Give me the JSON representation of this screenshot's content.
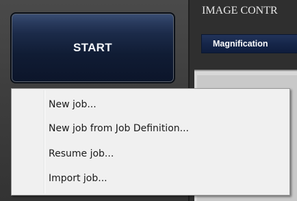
{
  "start_button": {
    "label": "START"
  },
  "image_control": {
    "title": "IMAGE CONTR",
    "tab_label": "Magnification"
  },
  "context_menu": {
    "items": [
      {
        "label": "New job..."
      },
      {
        "label": "New job from Job Definition..."
      },
      {
        "label": "Resume job..."
      },
      {
        "label": "Import job..."
      }
    ]
  },
  "colors": {
    "start_button_top": "#3b4f74",
    "start_button_bottom": "#0c152a",
    "menu_background": "#f0f0f0",
    "tab_background": "#16264a"
  }
}
